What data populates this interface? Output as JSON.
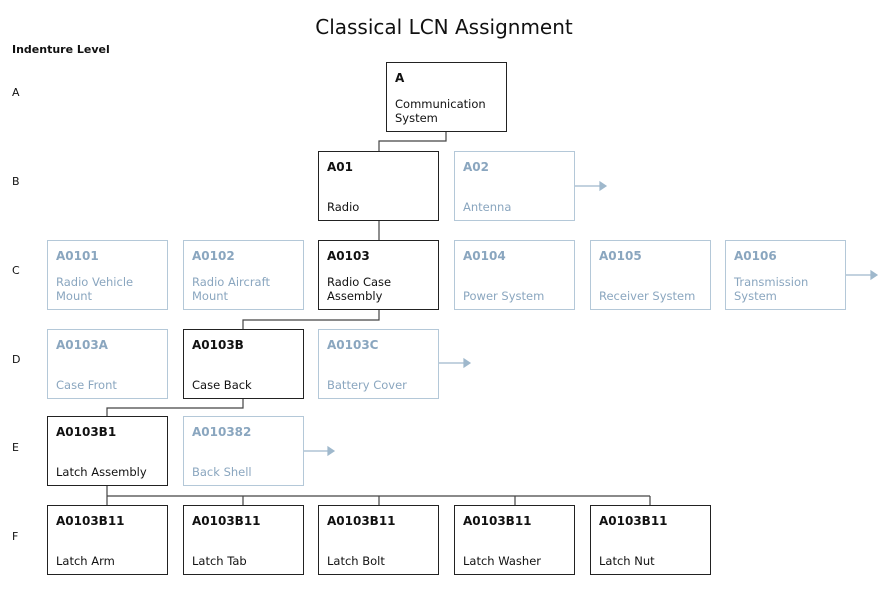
{
  "title": "Classical LCN Assignment",
  "legend_title": "Indenture Level",
  "levels": [
    "A",
    "B",
    "C",
    "D",
    "E",
    "F"
  ],
  "colors": {
    "active": "#222222",
    "inactive": "#b4c8d8",
    "inactive_text": "#8aa6bf"
  },
  "nodes": {
    "a": {
      "code": "A",
      "label": "Communication System",
      "state": "active"
    },
    "a01": {
      "code": "A01",
      "label": "Radio",
      "state": "active"
    },
    "a02": {
      "code": "A02",
      "label": "Antenna",
      "state": "inactive"
    },
    "a0101": {
      "code": "A0101",
      "label": "Radio Vehicle Mount",
      "state": "inactive"
    },
    "a0102": {
      "code": "A0102",
      "label": "Radio Aircraft Mount",
      "state": "inactive"
    },
    "a0103": {
      "code": "A0103",
      "label": "Radio Case Assembly",
      "state": "active"
    },
    "a0104": {
      "code": "A0104",
      "label": "Power System",
      "state": "inactive"
    },
    "a0105": {
      "code": "A0105",
      "label": "Receiver System",
      "state": "inactive"
    },
    "a0106": {
      "code": "A0106",
      "label": "Transmission System",
      "state": "inactive"
    },
    "a0103a": {
      "code": "A0103A",
      "label": "Case Front",
      "state": "inactive"
    },
    "a0103b": {
      "code": "A0103B",
      "label": "Case Back",
      "state": "active"
    },
    "a0103c": {
      "code": "A0103C",
      "label": "Battery Cover",
      "state": "inactive"
    },
    "a0103b1": {
      "code": "A0103B1",
      "label": "Latch Assembly",
      "state": "active"
    },
    "a010382": {
      "code": "A010382",
      "label": "Back Shell",
      "state": "inactive"
    },
    "f1": {
      "code": "A0103B11",
      "label": "Latch Arm",
      "state": "active"
    },
    "f2": {
      "code": "A0103B11",
      "label": "Latch Tab",
      "state": "active"
    },
    "f3": {
      "code": "A0103B11",
      "label": "Latch Bolt",
      "state": "active"
    },
    "f4": {
      "code": "A0103B11",
      "label": "Latch Washer",
      "state": "active"
    },
    "f5": {
      "code": "A0103B11",
      "label": "Latch Nut",
      "state": "active"
    }
  }
}
